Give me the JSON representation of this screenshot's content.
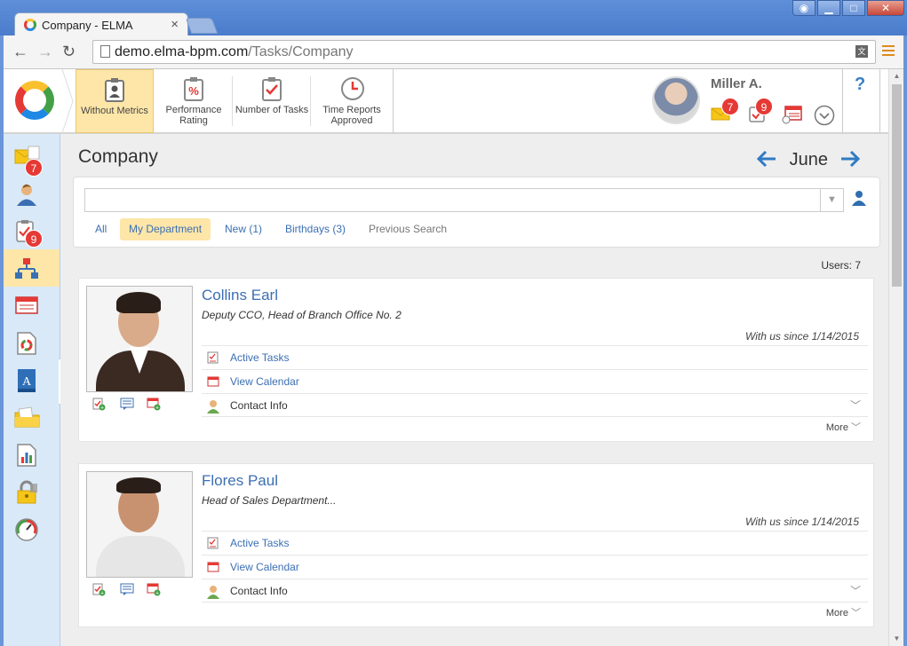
{
  "browser": {
    "tab_title": "Company - ELMA",
    "tab_close": "×",
    "url_host": "demo.elma-bpm.com",
    "url_path": "/Tasks/Company",
    "translate": "文"
  },
  "header": {
    "metrics": [
      {
        "label": "Without Metrics",
        "icon": "clipboard-user-icon",
        "active": true
      },
      {
        "label": "Performance Rating",
        "icon": "percent-clipboard-icon",
        "active": false
      },
      {
        "label": "Number of Tasks",
        "icon": "checklist-clipboard-icon",
        "active": false
      },
      {
        "label": "Time Reports Approved",
        "icon": "clock-icon",
        "active": false
      }
    ],
    "user_name": "Miller A.",
    "mail_badge": "7",
    "tasks_badge": "9",
    "help": "?"
  },
  "sidebar": {
    "items": [
      {
        "icon": "mail-icon",
        "badge": "7"
      },
      {
        "icon": "user-icon"
      },
      {
        "icon": "tasks-icon",
        "badge": "9"
      },
      {
        "icon": "org-structure-icon",
        "active": true
      },
      {
        "icon": "calendar-icon"
      },
      {
        "icon": "document-icon"
      },
      {
        "icon": "book-icon",
        "letter": "A"
      },
      {
        "icon": "folder-icon"
      },
      {
        "icon": "report-icon"
      },
      {
        "icon": "lock-icon"
      },
      {
        "icon": "gauge-icon"
      }
    ],
    "toggle": "›"
  },
  "main": {
    "title": "Company",
    "month": "June",
    "prev": "🡐",
    "next": "🡒",
    "search_placeholder": "",
    "filters": [
      {
        "label": "All"
      },
      {
        "label": "My Department",
        "active": true
      },
      {
        "label": "New (1)"
      },
      {
        "label": "Birthdays (3)"
      },
      {
        "label": "Previous Search",
        "muted": true
      }
    ],
    "users_count": "Users: 7"
  },
  "cards": [
    {
      "name": "Collins Earl",
      "position": "Deputy CCO, Head of Branch Office No. 2",
      "since": "With us since 1/14/2015",
      "rows": [
        "Active Tasks",
        "View Calendar",
        "Contact Info"
      ],
      "more": "More"
    },
    {
      "name": "Flores Paul",
      "position": "Head of Sales Department...",
      "since": "With us since 1/14/2015",
      "rows": [
        "Active Tasks",
        "View Calendar",
        "Contact Info"
      ],
      "more": "More"
    }
  ],
  "colors": {
    "accent": "#3b6fb3",
    "active_bg": "#fde6a8",
    "badge": "#e53935",
    "sidebar_bg": "#d9e9f8"
  }
}
